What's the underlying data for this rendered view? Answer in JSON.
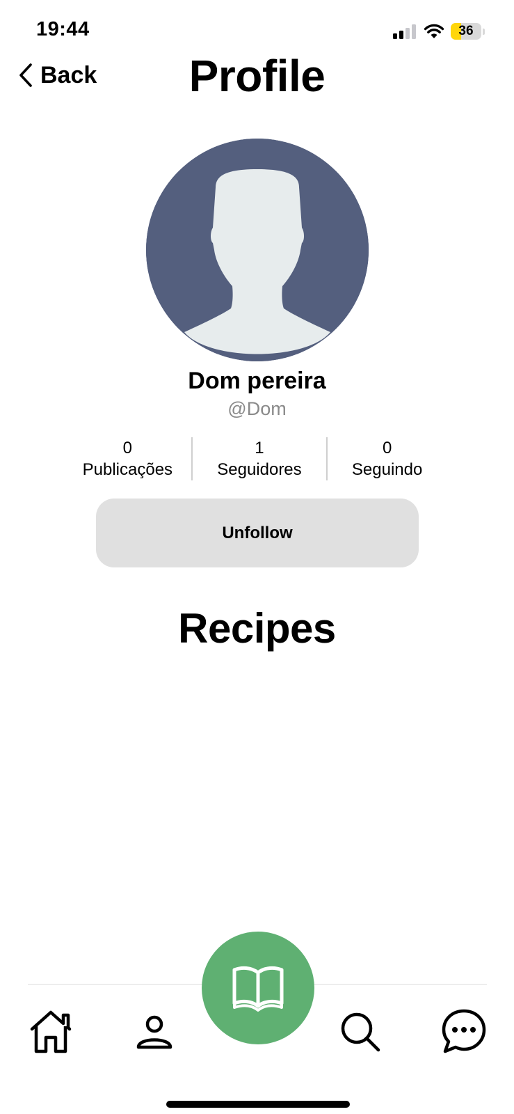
{
  "status_bar": {
    "time": "19:44",
    "battery_level": "36",
    "battery_color": "#ffd60a",
    "signal_icon": "cellular-signal-icon",
    "wifi_icon": "wifi-icon"
  },
  "header": {
    "back_label": "Back",
    "back_icon": "chevron-left-icon",
    "title": "Profile"
  },
  "profile": {
    "avatar_icon": "default-user-avatar",
    "avatar_bg": "#545f7e",
    "name": "Dom pereira",
    "handle": "@Dom"
  },
  "stats": [
    {
      "value": "0",
      "label": "Publicações"
    },
    {
      "value": "1",
      "label": "Seguidores"
    },
    {
      "value": "0",
      "label": "Seguindo"
    }
  ],
  "actions": {
    "follow_button_label": "Unfollow"
  },
  "recipes_section": {
    "title": "Recipes",
    "items": []
  },
  "tab_bar": {
    "accent_color": "#5fb072",
    "items": [
      {
        "icon": "home-icon"
      },
      {
        "icon": "person-icon"
      },
      {
        "icon": "open-book-icon"
      },
      {
        "icon": "search-icon"
      },
      {
        "icon": "chat-bubble-icon"
      }
    ]
  }
}
